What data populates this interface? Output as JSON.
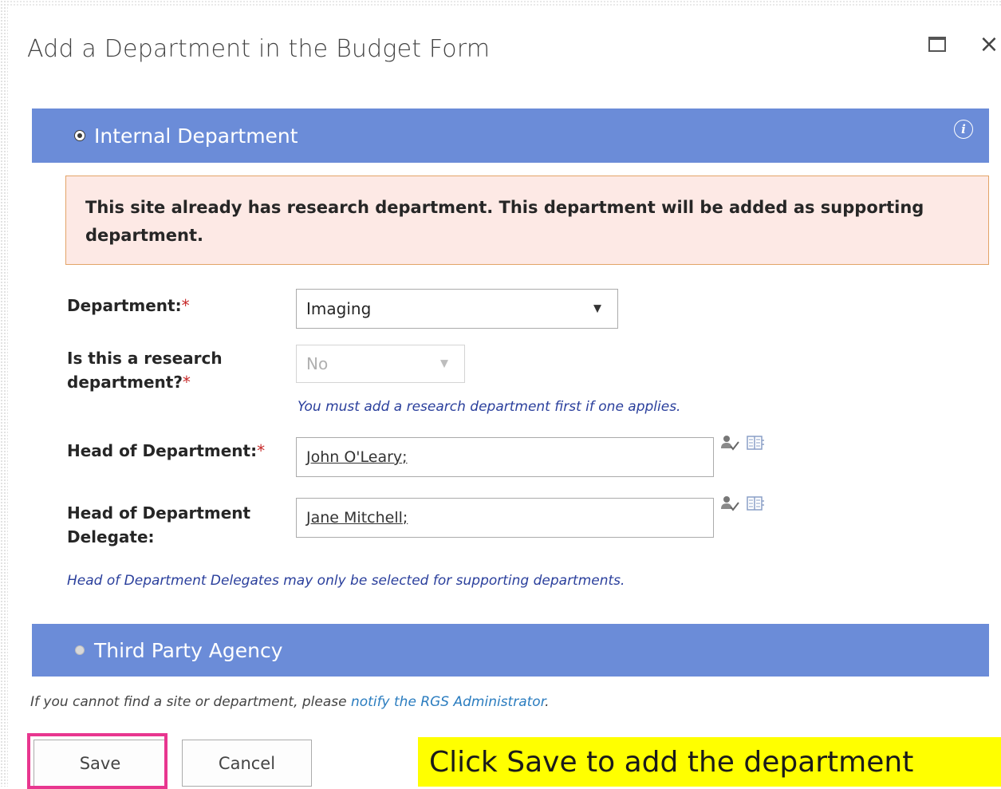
{
  "dialog": {
    "title": "Add a Department in the Budget Form",
    "maximize_icon": "maximize-icon",
    "close_icon": "close-icon",
    "close_glyph": "×"
  },
  "internal_section": {
    "label": "Internal Department",
    "selected": true,
    "info_glyph": "i",
    "warning": "This site already has research department. This department will be added as supporting department.",
    "fields": {
      "department": {
        "label": "Department:",
        "required_mark": "*",
        "value": "Imaging"
      },
      "is_research": {
        "label": "Is this a research department?",
        "required_mark": "*",
        "value": "No",
        "disabled": true,
        "hint": "You must add a research department first if one applies."
      },
      "head_of_department": {
        "label": "Head of Department:",
        "required_mark": "*",
        "value": "John O'Leary",
        "separator": ";"
      },
      "hod_delegate": {
        "label": "Head of Department Delegate:",
        "value": "Jane Mitchell",
        "separator": ";",
        "hint": "Head of Department Delegates may only be selected for supporting departments."
      }
    }
  },
  "third_party_section": {
    "label": "Third Party Agency",
    "selected": false
  },
  "footer": {
    "note_prefix": "If you cannot find a site or department, please ",
    "link_text": "notify the RGS Administrator",
    "note_suffix": "."
  },
  "buttons": {
    "save": "Save",
    "cancel": "Cancel"
  },
  "callout": {
    "text": "Click Save to add the department"
  },
  "colors": {
    "section_bar": "#6b8cd8",
    "warning_bg": "#fde9e5",
    "warning_border": "#e3a468",
    "hint_text": "#2a3f9c",
    "link": "#2a7cbf",
    "highlight_border": "#e8368f",
    "callout_bg": "#ffff00"
  }
}
